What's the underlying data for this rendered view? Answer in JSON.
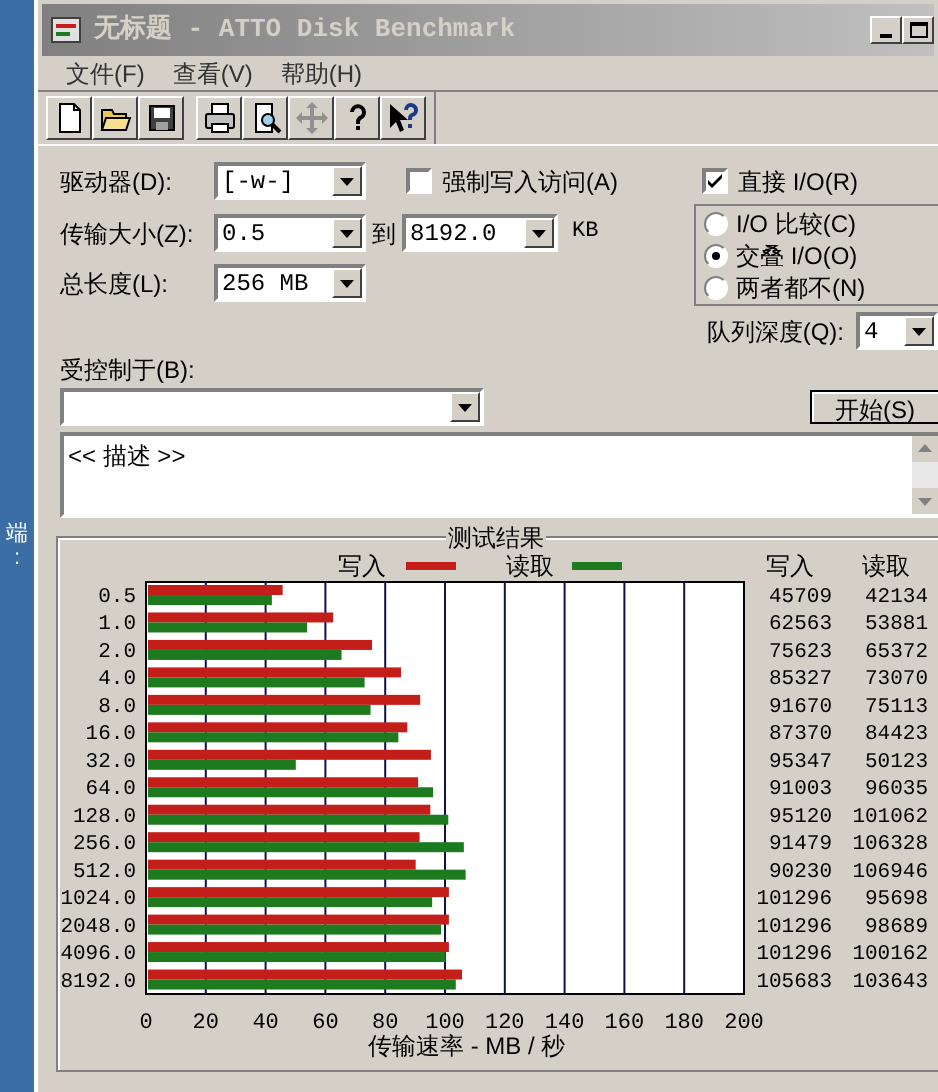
{
  "desktop_strip": {
    "text": "端:"
  },
  "window": {
    "title": "无标题 - ATTO Disk Benchmark"
  },
  "menu": [
    {
      "label": "文件(F)"
    },
    {
      "label": "查看(V)"
    },
    {
      "label": "帮助(H)"
    }
  ],
  "form": {
    "drive": {
      "label": "驱动器(D):",
      "value": "[-w-]"
    },
    "force_write": {
      "label": "强制写入访问(A)",
      "checked": false
    },
    "direct_io": {
      "label": "直接 I/O(R)",
      "checked": true
    },
    "transfer_size": {
      "label": "传输大小(Z):",
      "from": "0.5",
      "to_label": "到",
      "to": "8192.0",
      "unit": "KB"
    },
    "total_length": {
      "label": "总长度(L):",
      "value": "256 MB"
    },
    "io_mode": [
      {
        "label": "I/O 比较(C)",
        "selected": false
      },
      {
        "label": "交叠 I/O(O)",
        "selected": true
      },
      {
        "label": "两者都不(N)",
        "selected": false
      }
    ],
    "queue_depth": {
      "label": "队列深度(Q):",
      "value": "4"
    },
    "controlled_by": {
      "label": "受控制于(B):"
    },
    "start_button": "开始(S)",
    "description": "<< 描述 >>"
  },
  "results": {
    "title": "测试结果",
    "column_headers": [
      "写入",
      "读取"
    ],
    "rows": [
      {
        "write": "45709",
        "read": "42134"
      },
      {
        "write": "62563",
        "read": "53881"
      },
      {
        "write": "75623",
        "read": "65372"
      },
      {
        "write": "85327",
        "read": "73070"
      },
      {
        "write": "91670",
        "read": "75113"
      },
      {
        "write": "87370",
        "read": "84423"
      },
      {
        "write": "95347",
        "read": "50123"
      },
      {
        "write": "91003",
        "read": "96035"
      },
      {
        "write": "95120",
        "read": "101062"
      },
      {
        "write": "91479",
        "read": "106328"
      },
      {
        "write": "90230",
        "read": "106946"
      },
      {
        "write": "101296",
        "read": "95698"
      },
      {
        "write": "101296",
        "read": "98689"
      },
      {
        "write": "101296",
        "read": "100162"
      },
      {
        "write": "105683",
        "read": "103643"
      }
    ],
    "chart_data": {
      "type": "bar",
      "orientation": "horizontal",
      "xlabel": "传输速率 - MB / 秒",
      "categories": [
        "0.5",
        "1.0",
        "2.0",
        "4.0",
        "8.0",
        "16.0",
        "32.0",
        "64.0",
        "128.0",
        "256.0",
        "512.0",
        "1024.0",
        "2048.0",
        "4096.0",
        "8192.0"
      ],
      "series": [
        {
          "name": "写入",
          "color": "#c41e1a",
          "values": [
            45.7,
            62.6,
            75.6,
            85.3,
            91.7,
            87.4,
            95.3,
            91.0,
            95.1,
            91.5,
            90.2,
            101.3,
            101.3,
            101.3,
            105.7
          ]
        },
        {
          "name": "读取",
          "color": "#1e7a1e",
          "values": [
            42.1,
            53.9,
            65.4,
            73.1,
            75.1,
            84.4,
            50.1,
            96.0,
            101.1,
            106.3,
            106.9,
            95.7,
            98.7,
            100.2,
            103.6
          ]
        }
      ],
      "legend": true,
      "grid": true,
      "xlim": [
        0,
        200
      ],
      "xticks": [
        0,
        20,
        40,
        60,
        80,
        100,
        120,
        140,
        160,
        180,
        200
      ]
    }
  }
}
